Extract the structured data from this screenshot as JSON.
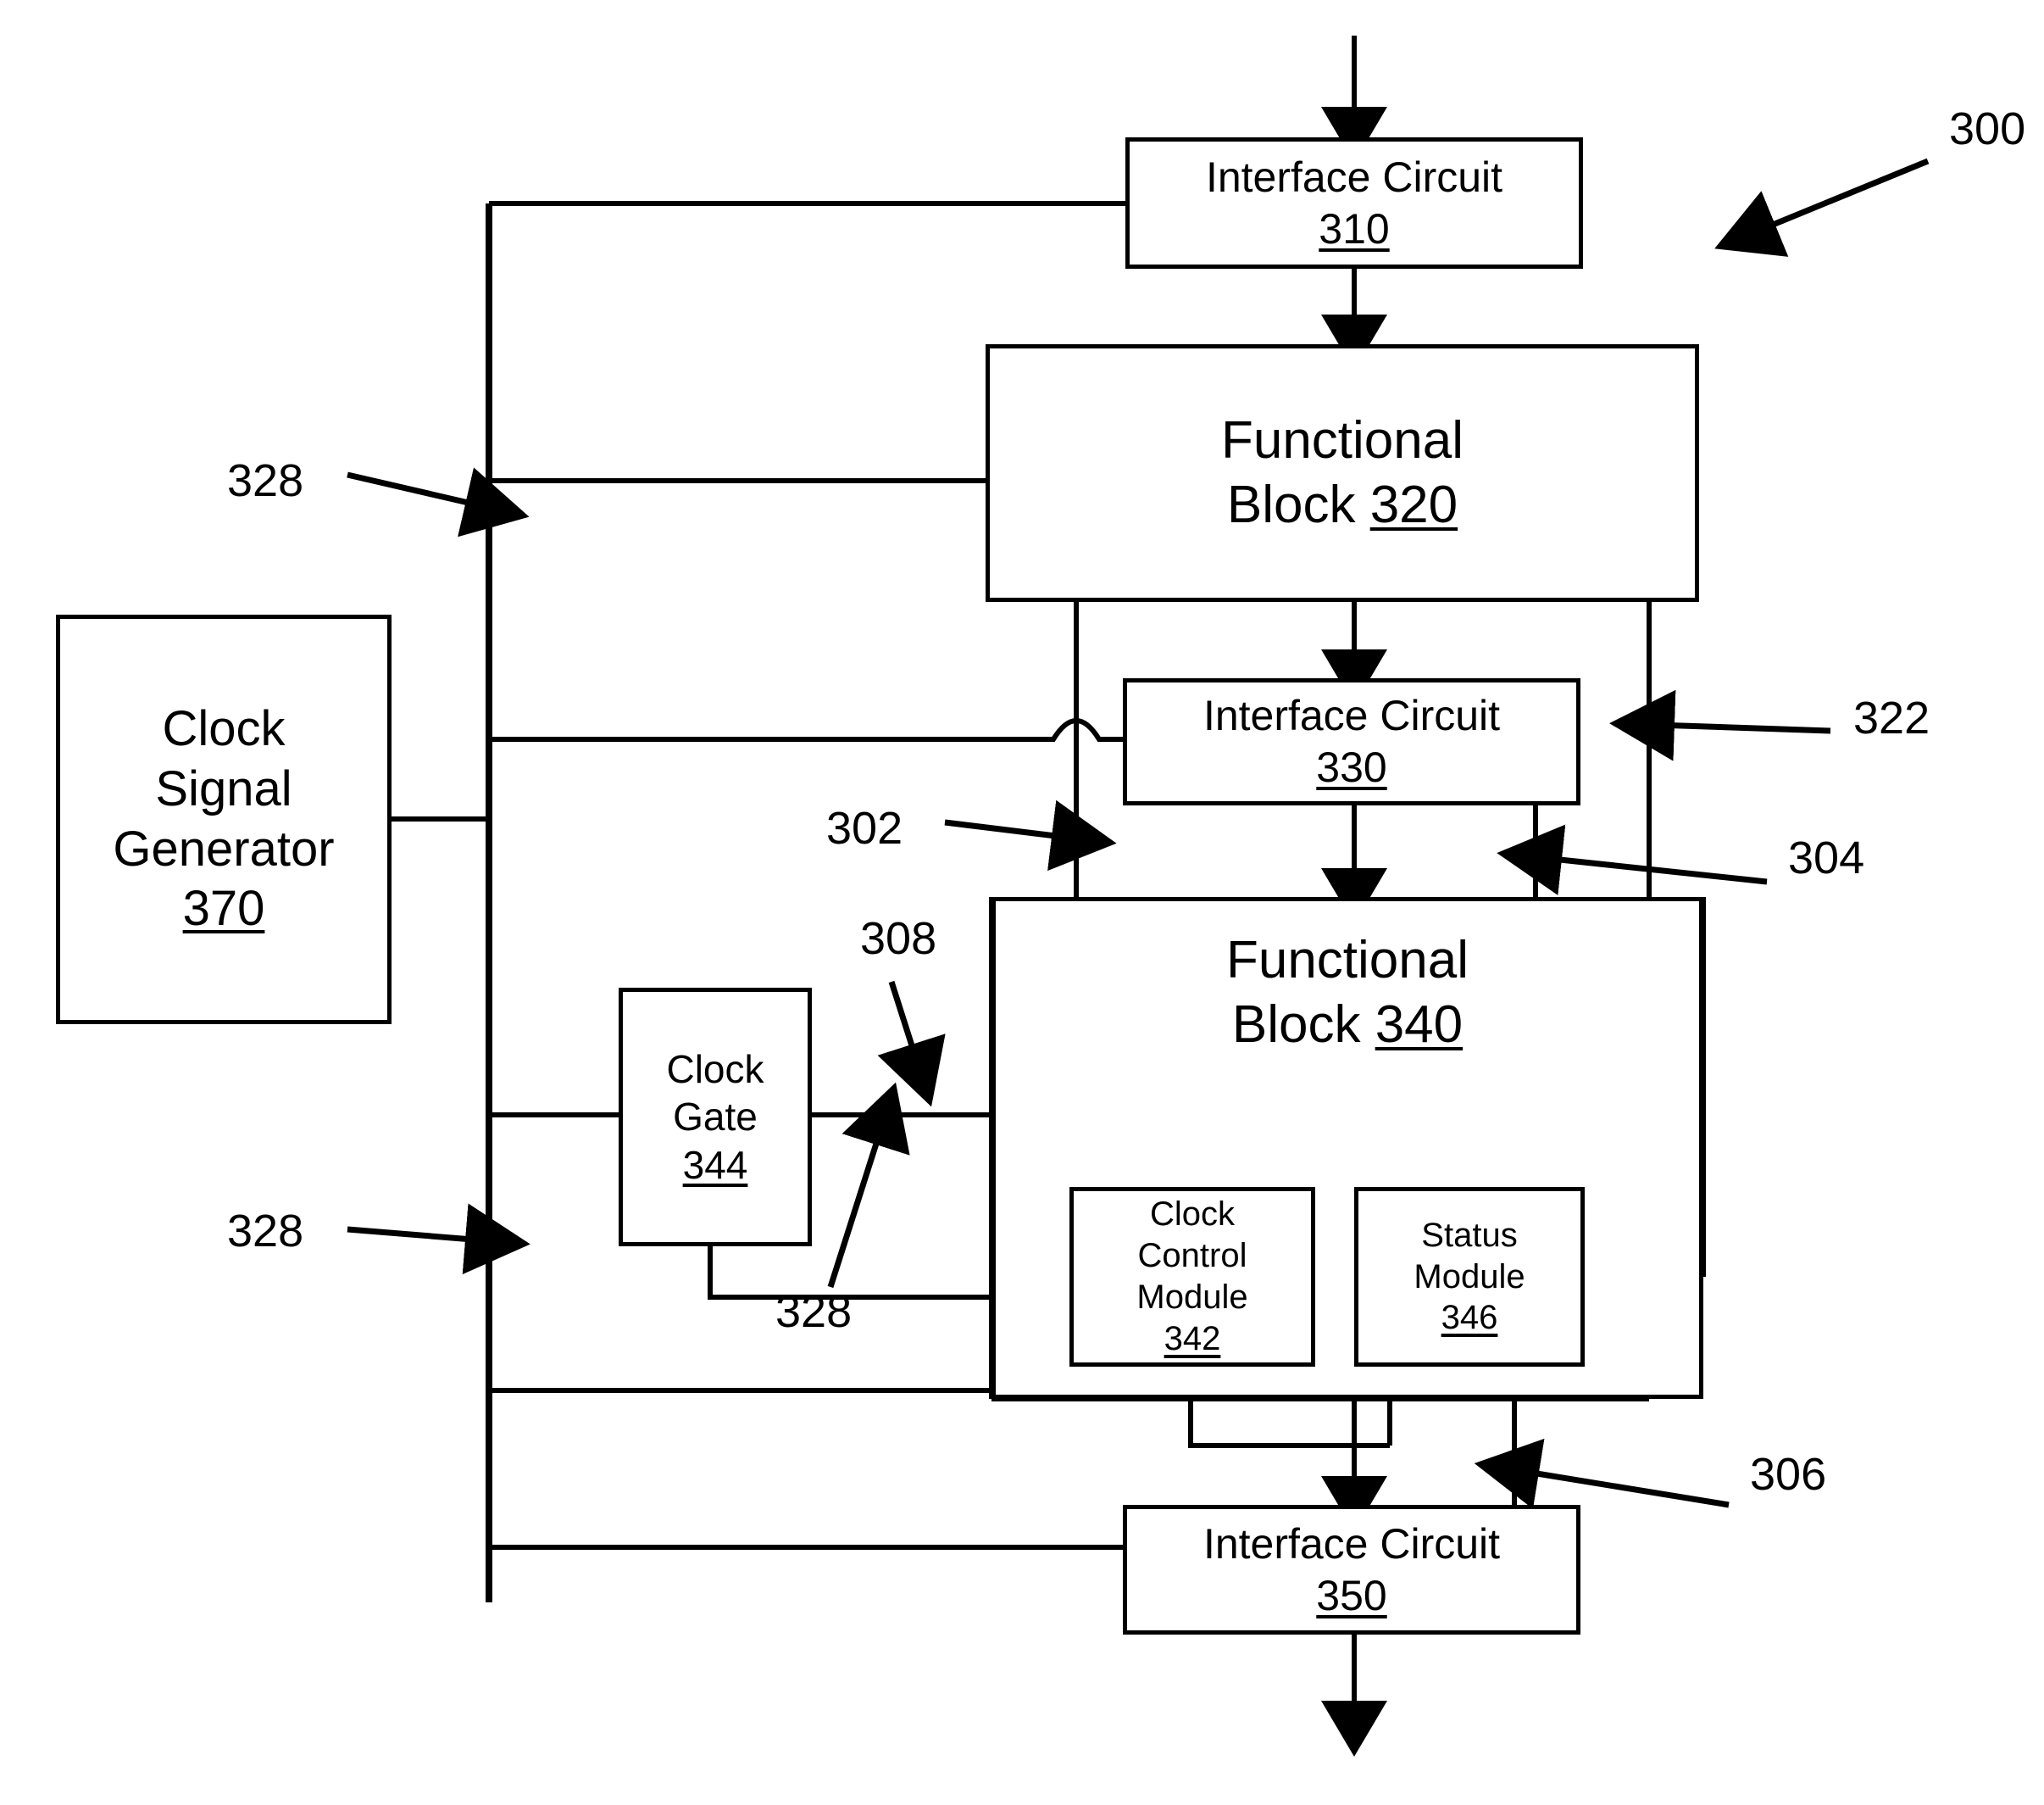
{
  "figure": {
    "reference_numeral": "300",
    "type": "patent-block-diagram"
  },
  "blocks": {
    "interface_circuit_310": {
      "title": "Interface Circuit",
      "number": "310"
    },
    "functional_block_320": {
      "title_line1": "Functional",
      "title_line2_prefix": "Block ",
      "number": "320"
    },
    "interface_circuit_330": {
      "title": "Interface Circuit",
      "number": "330"
    },
    "functional_block_340": {
      "title_line1": "Functional",
      "title_line2_prefix": "Block ",
      "number": "340"
    },
    "interface_circuit_350": {
      "title": "Interface Circuit",
      "number": "350"
    },
    "clock_signal_generator_370": {
      "line1": "Clock",
      "line2": "Signal",
      "line3": "Generator",
      "number": "370"
    },
    "clock_gate_344": {
      "line1": "Clock",
      "line2": "Gate",
      "number": "344"
    },
    "clock_control_module_342": {
      "line1": "Clock",
      "line2": "Control",
      "line3": "Module",
      "number": "342"
    },
    "status_module_346": {
      "line1": "Status",
      "line2": "Module",
      "number": "346"
    }
  },
  "reference_labels": {
    "fig_300": "300",
    "clock_bus_328_top": "328",
    "bus_322": "322",
    "signal_302": "302",
    "signal_304": "304",
    "signal_308": "308",
    "clock_bus_328_mid": "328",
    "clock_bus_328_gate": "328",
    "signal_306": "306"
  },
  "colors": {
    "line": "#000000",
    "background": "#ffffff",
    "text": "#000000"
  }
}
